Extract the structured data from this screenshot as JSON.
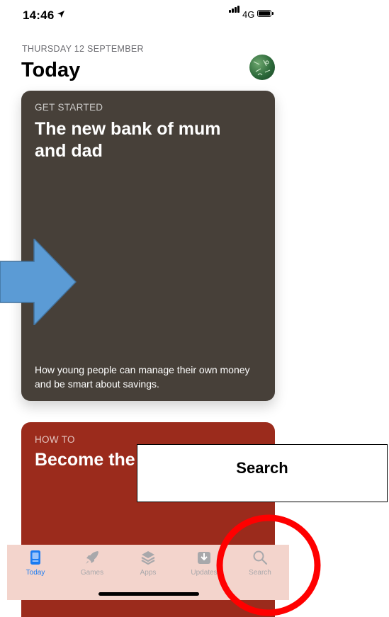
{
  "status_bar": {
    "time": "14:46",
    "network": "4G"
  },
  "header": {
    "date": "THURSDAY 12 SEPTEMBER",
    "title": "Today"
  },
  "cards": [
    {
      "eyebrow": "GET STARTED",
      "title": "The new bank of mum and dad",
      "description": "How young people can manage their own money and be smart about savings.",
      "color": "#474039"
    },
    {
      "eyebrow": "HOW TO",
      "title": "Become the big influenc",
      "color": "#9b2b1c"
    }
  ],
  "tab_bar": {
    "tabs": [
      {
        "label": "Today",
        "icon": "today-icon",
        "active": true
      },
      {
        "label": "Games",
        "icon": "rocket-icon",
        "active": false
      },
      {
        "label": "Apps",
        "icon": "layers-icon",
        "active": false
      },
      {
        "label": "Updates",
        "icon": "download-icon",
        "active": false
      },
      {
        "label": "Search",
        "icon": "search-icon",
        "active": false
      }
    ]
  },
  "annotations": {
    "callout_label": "Search",
    "arrow_color": "#5b9bd5",
    "circle_color": "#ff0000"
  },
  "colors": {
    "accent": "#1b7cf2",
    "inactive": "#a8a8ab"
  }
}
